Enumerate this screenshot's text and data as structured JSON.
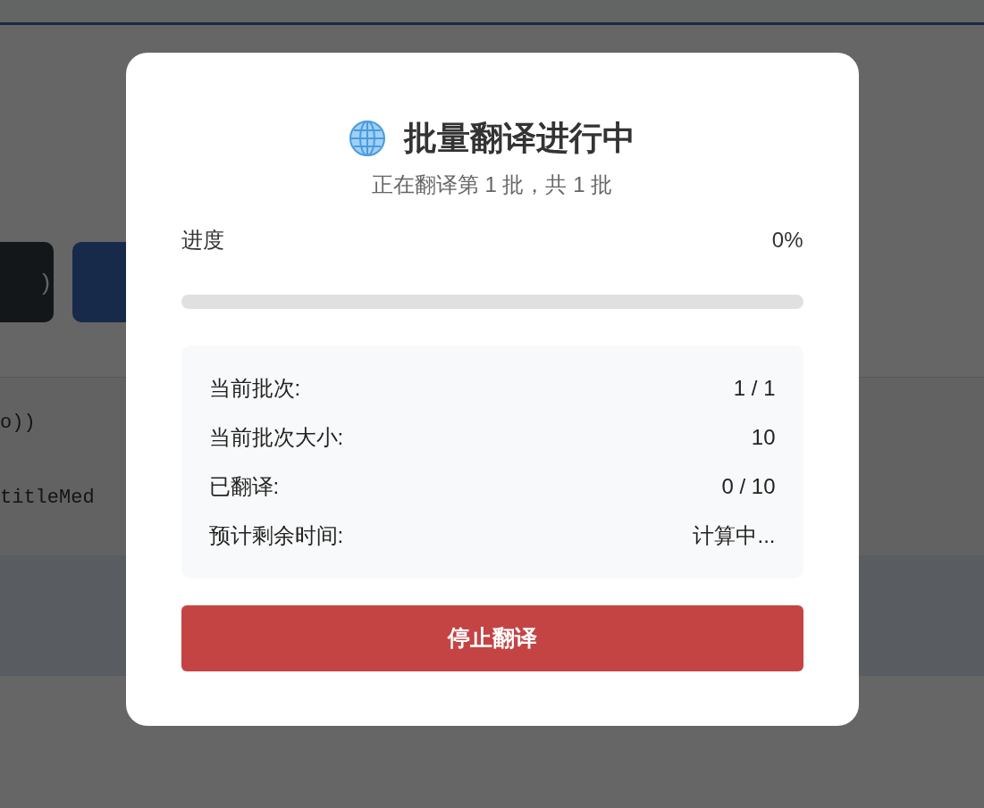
{
  "background": {
    "buttons": [
      {
        "label": ")",
        "kind": "dark"
      },
      {
        "kind": "primary"
      }
    ],
    "code_lines": [
      "o))",
      "titleMed"
    ]
  },
  "dialog": {
    "title": "批量翻译进行中",
    "subtitle": "正在翻译第 1 批，共 1 批",
    "progress": {
      "label": "进度",
      "reading": "0%",
      "level": 0
    },
    "stats": [
      {
        "label": "当前批次:",
        "value": "1 / 1"
      },
      {
        "label": "当前批次大小:",
        "value": "10"
      },
      {
        "label": "已翻译:",
        "value": "0 / 10"
      },
      {
        "label": "预计剩余时间:",
        "value": "计算中..."
      }
    ],
    "stop_button": "停止翻译"
  }
}
